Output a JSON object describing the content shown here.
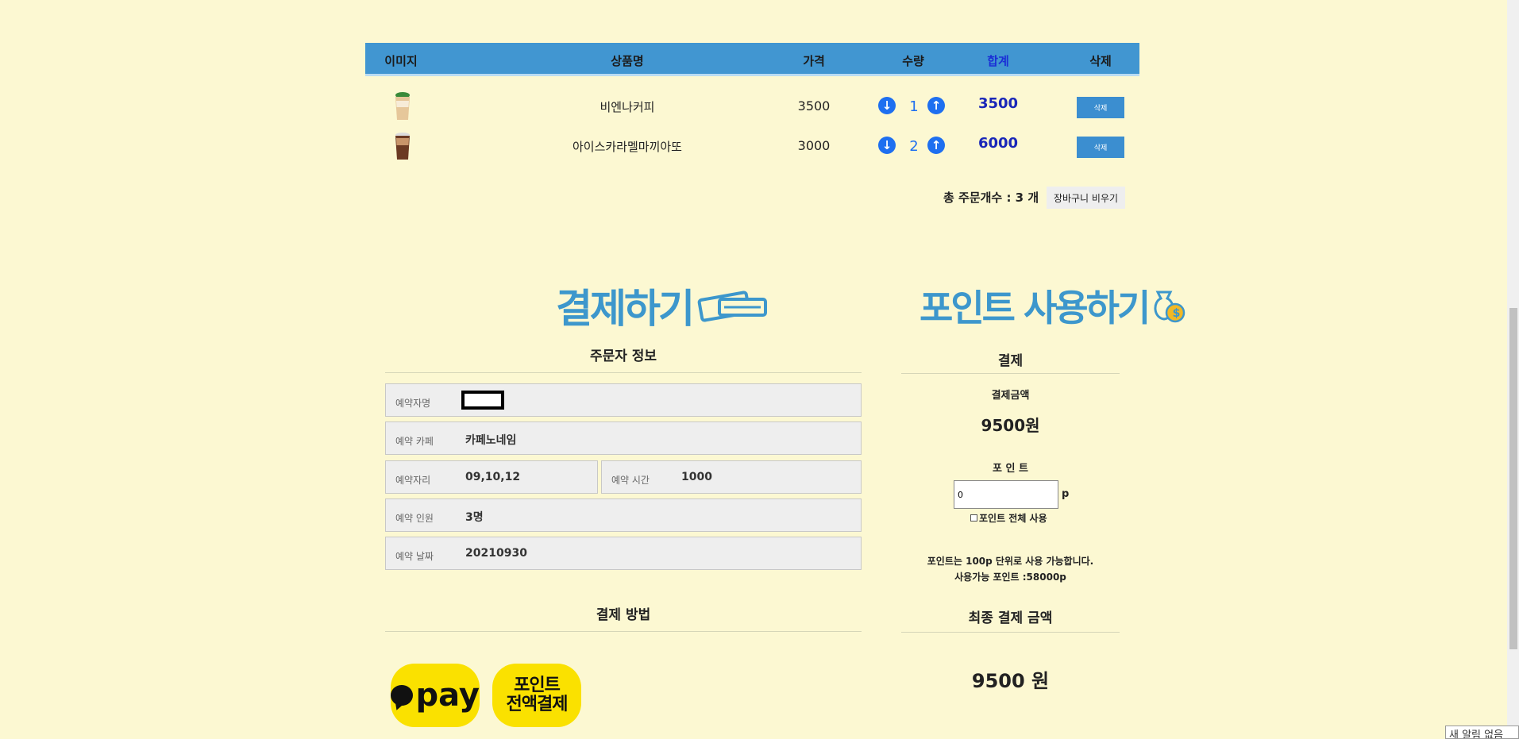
{
  "cart": {
    "headers": {
      "image": "이미지",
      "name": "상품명",
      "price": "가격",
      "qty": "수량",
      "total": "합계",
      "delete": "삭제"
    },
    "rows": [
      {
        "name": "비엔나커피",
        "price": "3500",
        "qty": "1",
        "total": "3500",
        "delete_label": "삭제"
      },
      {
        "name": "아이스카라멜마끼아또",
        "price": "3000",
        "qty": "2",
        "total": "6000",
        "delete_label": "삭제"
      }
    ],
    "summary": "총 주문개수 : 3 개",
    "empty_button": "장바구니 비우기"
  },
  "banners": {
    "pay": "결제하기",
    "point": "포인트 사용하기"
  },
  "orderer": {
    "title": "주문자 정보",
    "fields": {
      "name_label": "예약자명",
      "cafe_label": "예약 카페",
      "cafe_value": "카페노네임",
      "seat_label": "예약자리",
      "seat_value": "09,10,12",
      "time_label": "예약 시간",
      "time_value": "1000",
      "people_label": "예약 인원",
      "people_value": "3명",
      "date_label": "예약 날짜",
      "date_value": "20210930"
    }
  },
  "payment_method": {
    "title": "결제 방법",
    "kakao_label": "pay",
    "point_line1": "포인트",
    "point_line2": "전액결제"
  },
  "payment": {
    "title": "결제",
    "amount_label": "결제금액",
    "amount_value": "9500원",
    "point_label": "포 인 트",
    "point_input_value": "0",
    "point_suffix": "p",
    "use_all_label": "포인트 전체 사용",
    "note_line1": "포인트는 100p 단위로 사용 가능합니다.",
    "note_line2": "사용가능 포인트 :58000p",
    "final_title": "최종 결제 금액",
    "final_value": "9500 원"
  },
  "system": {
    "notification": "새 알림 없음"
  },
  "colors": {
    "background": "#fcf8d2",
    "header_blue": "#4196d1",
    "accent_blue": "#1e6ff0",
    "kakao_yellow": "#fae100"
  }
}
